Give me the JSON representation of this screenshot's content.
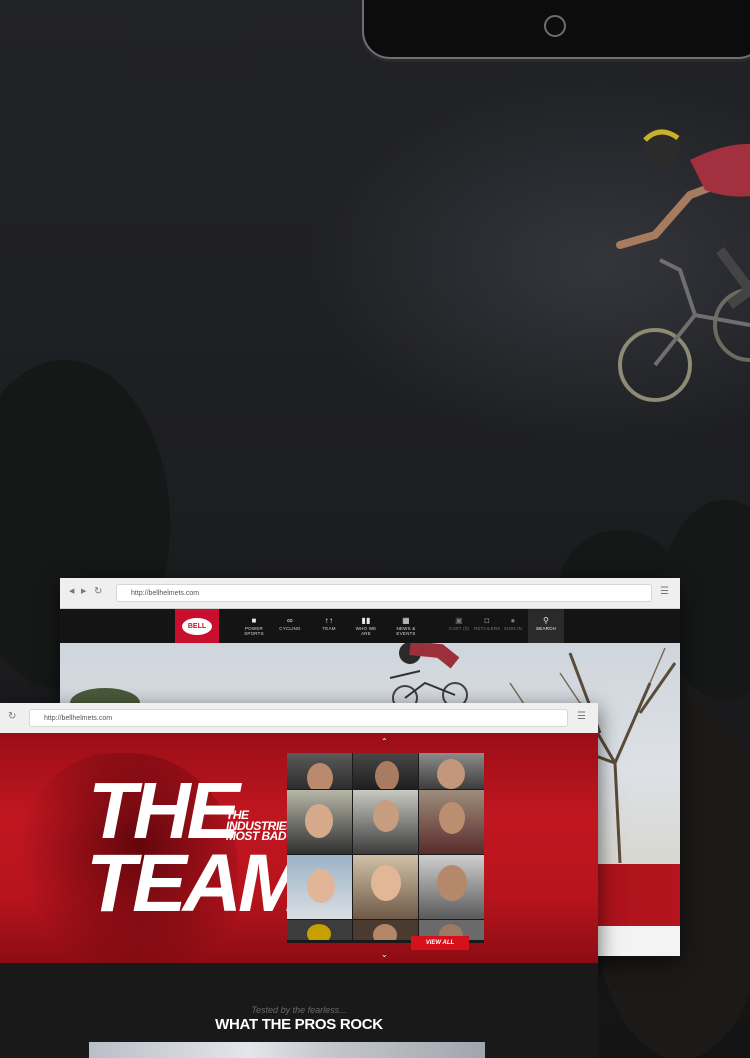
{
  "back_browser": {
    "url": "http://bellhelmets.com",
    "logo_text": "BELL",
    "nav": [
      {
        "label": "POWER SPORTS",
        "icon": "helmet-icon"
      },
      {
        "label": "CYCLING",
        "icon": "bicycle-icon"
      },
      {
        "label": "TEAM",
        "icon": "people-icon"
      },
      {
        "label": "WHO WE ARE",
        "icon": "flag-icon"
      },
      {
        "label": "NEWS & EVENTS",
        "icon": "newspaper-icon"
      }
    ],
    "utility": [
      {
        "label": "CART (0)",
        "icon": "cart-icon"
      },
      {
        "label": "RETAILERS",
        "icon": "map-icon"
      },
      {
        "label": "SIGN IN",
        "icon": "user-icon"
      }
    ],
    "search_label": "SEARCH"
  },
  "front_browser": {
    "url": "http://bellhelmets.com",
    "title_line1": "THE",
    "title_line2": "TEAM",
    "tagline": [
      "THE",
      "INDUSTRIES",
      "MOST BAD ASS"
    ],
    "view_all": "VIEW ALL"
  },
  "bottom": {
    "kicker": "Tested by the fearless...",
    "heading": "WHAT THE PROS ROCK"
  },
  "colors": {
    "brand_red": "#c8102e",
    "nav_bg": "#141414"
  }
}
